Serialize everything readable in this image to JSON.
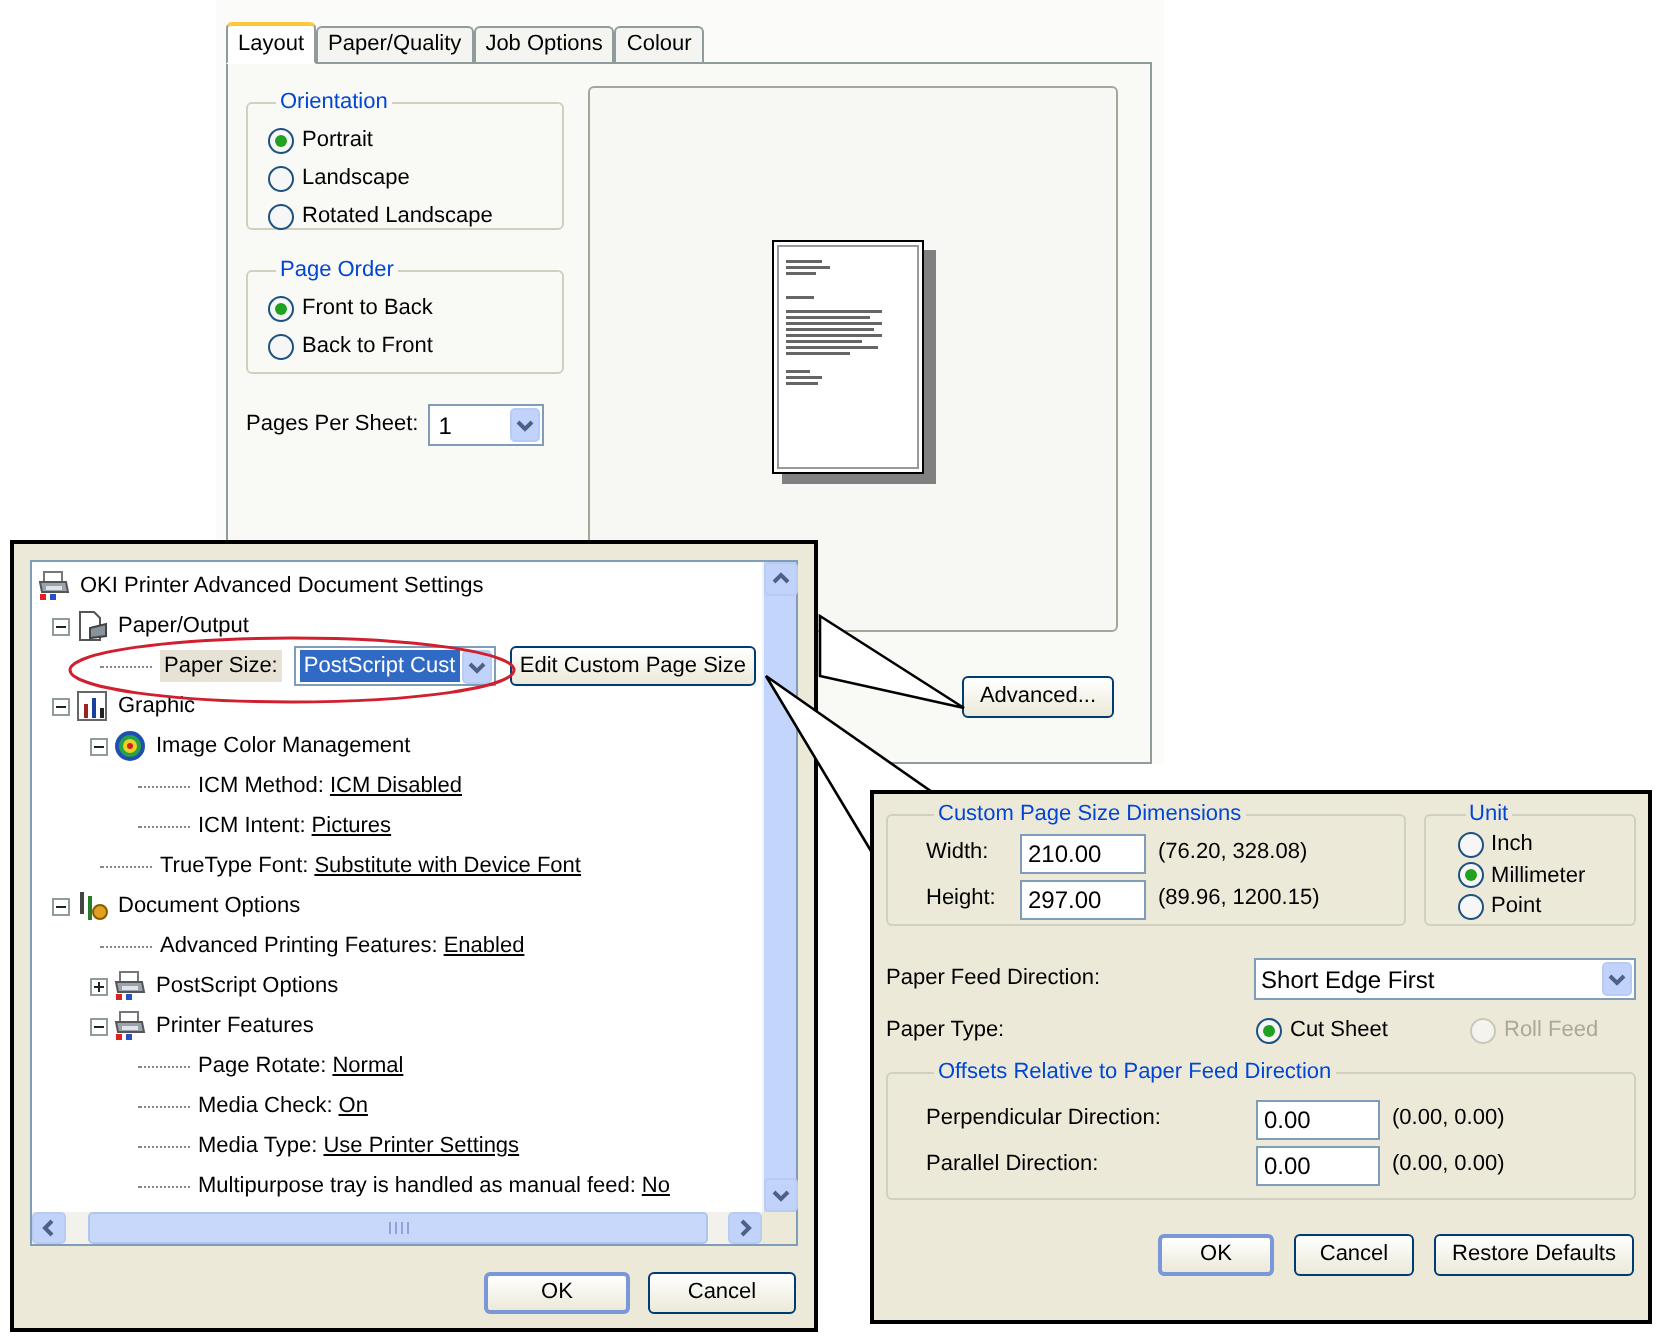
{
  "layout_dialog": {
    "tabs": [
      {
        "label": "Layout",
        "selected": true
      },
      {
        "label": "Paper/Quality",
        "selected": false
      },
      {
        "label": "Job Options",
        "selected": false
      },
      {
        "label": "Colour",
        "selected": false
      }
    ],
    "orientation": {
      "title": "Orientation",
      "options": [
        {
          "label": "Portrait",
          "selected": true
        },
        {
          "label": "Landscape",
          "selected": false
        },
        {
          "label": "Rotated Landscape",
          "selected": false
        }
      ]
    },
    "page_order": {
      "title": "Page Order",
      "options": [
        {
          "label": "Front to Back",
          "selected": true
        },
        {
          "label": "Back to Front",
          "selected": false
        }
      ]
    },
    "pages_per_sheet": {
      "label": "Pages Per Sheet:",
      "value": "1"
    },
    "advanced_button": "Advanced..."
  },
  "advanced_dialog": {
    "tree": [
      {
        "kind": "printer",
        "label": "OKI Printer Advanced Document Settings",
        "children": [
          {
            "kind": "page",
            "label": "Paper/Output",
            "expanded": true,
            "children": [
              {
                "kind": "paper_size",
                "label": "Paper Size:",
                "value": "PostScript Cust",
                "button": "Edit Custom Page Size"
              }
            ]
          },
          {
            "kind": "chart",
            "label": "Graphic",
            "expanded": true,
            "children": [
              {
                "kind": "target",
                "label": "Image Color Management",
                "expanded": true,
                "children": [
                  {
                    "kind": "setting",
                    "label": "ICM Method:",
                    "value": "ICM Disabled"
                  },
                  {
                    "kind": "setting",
                    "label": "ICM Intent:",
                    "value": "Pictures"
                  }
                ]
              },
              {
                "kind": "setting",
                "label": "TrueType Font:",
                "value": "Substitute with Device Font"
              }
            ]
          },
          {
            "kind": "tools",
            "label": "Document Options",
            "expanded": true,
            "children": [
              {
                "kind": "setting",
                "label": "Advanced Printing Features:",
                "value": "Enabled"
              },
              {
                "kind": "printer",
                "label": "PostScript Options",
                "expanded": false
              },
              {
                "kind": "printer",
                "label": "Printer Features",
                "expanded": true,
                "children": [
                  {
                    "kind": "setting",
                    "label": "Page Rotate:",
                    "value": "Normal"
                  },
                  {
                    "kind": "setting",
                    "label": "Media Check:",
                    "value": "On"
                  },
                  {
                    "kind": "setting",
                    "label": "Media Type:",
                    "value": "Use Printer Settings"
                  },
                  {
                    "kind": "setting",
                    "label": "Multipurpose tray is handled as manual feed:",
                    "value": "No"
                  }
                ]
              }
            ]
          }
        ]
      }
    ],
    "buttons": [
      "OK",
      "Cancel"
    ]
  },
  "custom_page_size_dialog": {
    "dimensions": {
      "title": "Custom Page Size Dimensions",
      "fields": [
        {
          "label": "Width:",
          "value": "210.00",
          "range": "(76.20, 328.08)"
        },
        {
          "label": "Height:",
          "value": "297.00",
          "range": "(89.96, 1200.15)"
        }
      ]
    },
    "unit": {
      "title": "Unit",
      "options": [
        {
          "label": "Inch",
          "selected": false
        },
        {
          "label": "Millimeter",
          "selected": true
        },
        {
          "label": "Point",
          "selected": false
        }
      ]
    },
    "paper_feed_direction": {
      "label": "Paper Feed Direction:",
      "value": "Short Edge First"
    },
    "paper_type": {
      "label": "Paper Type:",
      "options": [
        {
          "label": "Cut Sheet",
          "selected": true,
          "disabled": false
        },
        {
          "label": "Roll Feed",
          "selected": false,
          "disabled": true
        }
      ]
    },
    "offsets": {
      "title": "Offsets Relative to Paper Feed Direction",
      "fields": [
        {
          "label": "Perpendicular Direction:",
          "value": "0.00",
          "range": "(0.00, 0.00)"
        },
        {
          "label": "Parallel Direction:",
          "value": "0.00",
          "range": "(0.00, 0.00)"
        }
      ]
    },
    "buttons": [
      "OK",
      "Cancel",
      "Restore Defaults"
    ]
  }
}
